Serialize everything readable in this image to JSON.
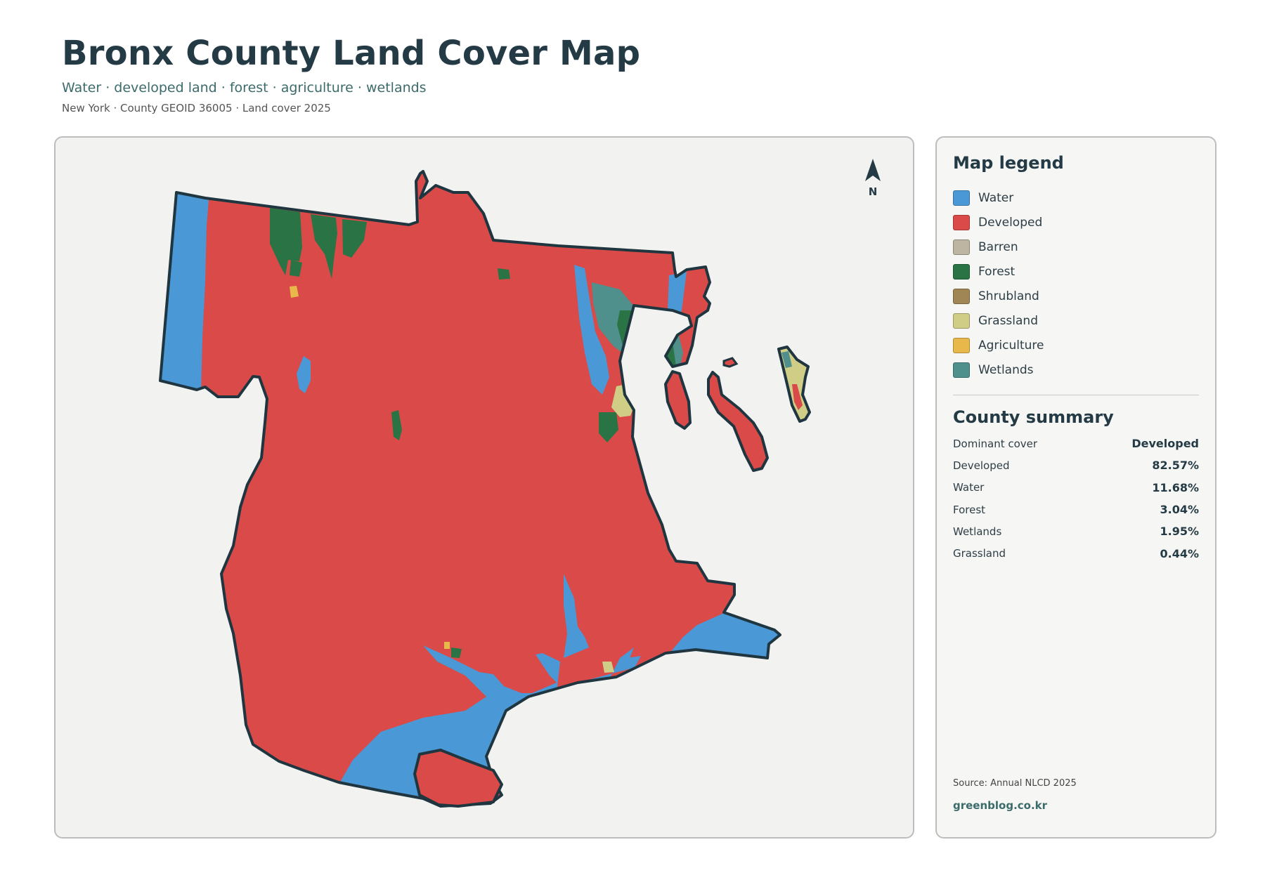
{
  "header": {
    "title": "Bronx County Land Cover Map",
    "subtitle": "Water · developed land · forest · agriculture · wetlands",
    "meta": "New York · County GEOID 36005 · Land cover 2025"
  },
  "map": {
    "north_label": "N",
    "colors": {
      "water": "#4a98d6",
      "developed": "#d94a48",
      "forest": "#2a7344",
      "grassland": "#cfcd86",
      "agriculture": "#e8b94a",
      "wetlands": "#4f8f8c",
      "outline": "#1f3640"
    }
  },
  "legend": {
    "title": "Map legend",
    "items": [
      {
        "label": "Water",
        "color": "#4a98d6"
      },
      {
        "label": "Developed",
        "color": "#d94a48"
      },
      {
        "label": "Barren",
        "color": "#bdb5a2"
      },
      {
        "label": "Forest",
        "color": "#2a7344"
      },
      {
        "label": "Shrubland",
        "color": "#a08555"
      },
      {
        "label": "Grassland",
        "color": "#cfcd86"
      },
      {
        "label": "Agriculture",
        "color": "#e8b94a"
      },
      {
        "label": "Wetlands",
        "color": "#4f8f8c"
      }
    ]
  },
  "summary": {
    "title": "County summary",
    "rows": [
      {
        "key": "Dominant cover",
        "value": "Developed"
      },
      {
        "key": "Developed",
        "value": "82.57%"
      },
      {
        "key": "Water",
        "value": "11.68%"
      },
      {
        "key": "Forest",
        "value": "3.04%"
      },
      {
        "key": "Wetlands",
        "value": "1.95%"
      },
      {
        "key": "Grassland",
        "value": "0.44%"
      }
    ]
  },
  "footer": {
    "source": "Source: Annual NLCD 2025",
    "credit": "greenblog.co.kr"
  }
}
